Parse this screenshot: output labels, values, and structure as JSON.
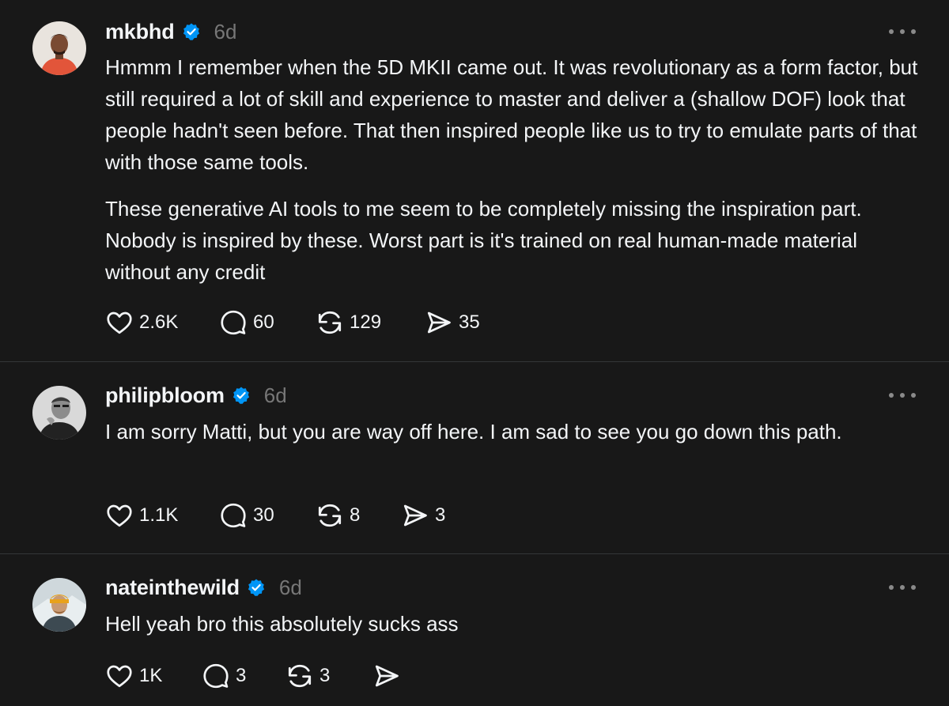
{
  "posts": [
    {
      "username": "mkbhd",
      "time": "6d",
      "paragraphs": [
        "Hmmm I remember when the 5D MKII came out. It was revolutionary as a form factor, but still required a lot of skill and experience to master and deliver a (shallow DOF) look that people hadn't seen before. That then inspired people like us to try to emulate parts of that with those same tools.",
        "These generative AI tools to me seem to be completely missing the inspiration part. Nobody is inspired by these. Worst part is it's trained on real human-made material without any credit"
      ],
      "likes": "2.6K",
      "replies": "60",
      "reposts": "129",
      "shares": "35"
    },
    {
      "username": "philipbloom",
      "time": "6d",
      "paragraphs": [
        "I am sorry Matti, but you are way off here. I am sad to see you go down this path."
      ],
      "likes": "1.1K",
      "replies": "30",
      "reposts": "8",
      "shares": "3"
    },
    {
      "username": "nateinthewild",
      "time": "6d",
      "paragraphs": [
        "Hell yeah bro this absolutely sucks ass"
      ],
      "likes": "1K",
      "replies": "3",
      "reposts": "3",
      "shares": ""
    }
  ],
  "icons": {
    "verified": "verified-badge-icon",
    "like": "heart-icon",
    "reply": "speech-bubble-icon",
    "repost": "repost-icon",
    "share": "send-icon",
    "more": "more-dots-icon"
  },
  "colors": {
    "background": "#181818",
    "text": "#f3f5f7",
    "muted": "#777777",
    "verified": "#0095f6",
    "divider": "#333638"
  }
}
